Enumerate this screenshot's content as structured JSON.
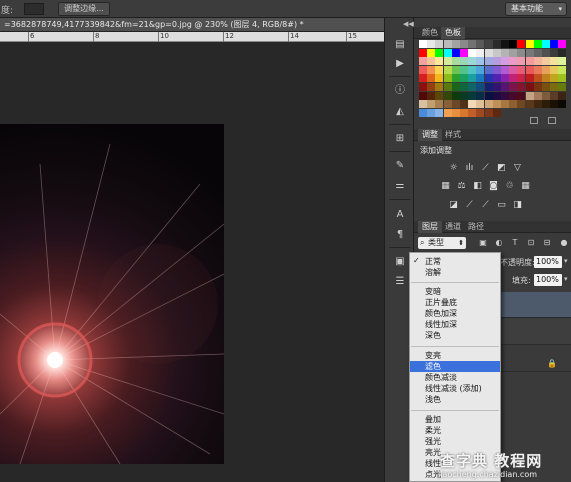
{
  "options_bar": {
    "field_label": "度:",
    "refine_edge_button": "调整边缘...",
    "workspace": "基本功能"
  },
  "document": {
    "tab_title": "=3682878749,4177339842&fm=21&gp=0.jpg @ 230% (图层 4, RGB/8#) *"
  },
  "ruler": {
    "labels": [
      "6",
      "8",
      "10",
      "12",
      "14",
      "15"
    ]
  },
  "panels": {
    "color_tabs": [
      "颜色",
      "色板"
    ],
    "adjust_tabs": [
      "调整",
      "样式"
    ],
    "adjust_title": "添加调整",
    "layers_tabs": [
      "图层",
      "通道",
      "路径"
    ],
    "filter_type": "类型",
    "opacity_label": "不透明度:",
    "opacity_value": "100%",
    "fill_label": "填充:",
    "fill_value": "100%"
  },
  "swatch_colors": [
    [
      "#ffffff",
      "#e8e8e8",
      "#d0d0d0",
      "#bababa",
      "#a2a2a2",
      "#8a8a8a",
      "#727272",
      "#5a5a5a",
      "#424242",
      "#2a2a2a",
      "#121212",
      "#000000",
      "#ff0000",
      "#ffff00",
      "#00ff00",
      "#00ffff",
      "#0000ff",
      "#ff00ff"
    ],
    [
      "#ff0000",
      "#ffff00",
      "#00ff00",
      "#00ffff",
      "#0000ff",
      "#ff00ff",
      "#ffffff",
      "#f0f0f0",
      "#dcdcdc",
      "#c8c8c8",
      "#b4b4b4",
      "#a0a0a0",
      "#8c8c8c",
      "#787878",
      "#646464",
      "#505050",
      "#3c3c3c",
      "#282828"
    ],
    [
      "#f4a0a0",
      "#f6c49a",
      "#fbe79c",
      "#d6ea9c",
      "#a8dc9c",
      "#9cd6b8",
      "#9cd6d6",
      "#9cc4ea",
      "#a0a8e0",
      "#b89ce0",
      "#d69ce0",
      "#ea9cc8",
      "#f09cb0",
      "#f29c9c",
      "#f2b49c",
      "#f2cc9c",
      "#f2e49c",
      "#dcf29c"
    ],
    [
      "#ef5a5a",
      "#f2924e",
      "#f8d450",
      "#b8dc50",
      "#6cc454",
      "#50c48c",
      "#50c4c4",
      "#50a4dc",
      "#5a6cd0",
      "#845ad0",
      "#b45ad0",
      "#dc5aa4",
      "#e85a78",
      "#e85a5a",
      "#e87a5a",
      "#e8a05a",
      "#e8c85a",
      "#c4e85a"
    ],
    [
      "#d81e1e",
      "#e0641a",
      "#f0b81a",
      "#8cbc1a",
      "#2ea02e",
      "#1aa060",
      "#1aa0a0",
      "#1a78c0",
      "#2234b0",
      "#5222b0",
      "#8a22b0",
      "#c02278",
      "#d02248",
      "#c01e1e",
      "#c0501e",
      "#c0801e",
      "#c0a81e",
      "#a0c01e"
    ],
    [
      "#8c1010",
      "#944010",
      "#a07a10",
      "#5a7a10",
      "#1a661a",
      "#10663e",
      "#106666",
      "#104c7c",
      "#141e72",
      "#341472",
      "#581472",
      "#7c144c",
      "#861430",
      "#7a1010",
      "#7a3210",
      "#7a5210",
      "#7a6c10",
      "#667a10"
    ],
    [
      "#500808",
      "#562408",
      "#5c4608",
      "#344608",
      "#0e3a0e",
      "#083a24",
      "#083a3a",
      "#082c48",
      "#0a1042",
      "#1e0a42",
      "#320a42",
      "#480a2c",
      "#4e0a1c",
      "#c4a484",
      "#a47c5c",
      "#7c5c3c",
      "#5c3c24",
      "#3c2414"
    ],
    [
      "#d8c0a0",
      "#c0a070",
      "#a88050",
      "#886038",
      "#6c4828",
      "#503018",
      "#f0d8b8",
      "#e0c098",
      "#d0a878",
      "#c09058",
      "#a87840",
      "#8c6030",
      "#704820",
      "#583818",
      "#402810",
      "#2c1c08",
      "#1c1004",
      "#0c0804"
    ],
    [
      "#4a8ad8",
      "#6aa0e0",
      "#8ab4e8",
      "#f0a050",
      "#e89040",
      "#d87830",
      "#c06028",
      "#a04820",
      "#803818",
      "#602810"
    ]
  ],
  "blend_modes": {
    "group1": [
      "正常",
      "溶解"
    ],
    "group2": [
      "变暗",
      "正片叠底",
      "颜色加深",
      "线性加深",
      "深色"
    ],
    "group3": [
      "变亮",
      "滤色",
      "颜色减淡",
      "线性减淡 (添加)",
      "浅色"
    ],
    "group4": [
      "叠加",
      "柔光",
      "强光",
      "亮光",
      "线性光",
      "点光"
    ],
    "checked": "正常",
    "selected": "滤色"
  },
  "watermark": {
    "logo": "查字典 教程网",
    "url": "jiaocheng.chazidian.com"
  },
  "colors": {
    "menu_selected": "#3b71dc",
    "panel_bg": "#3a3a3a",
    "pasteboard": "#282828"
  }
}
